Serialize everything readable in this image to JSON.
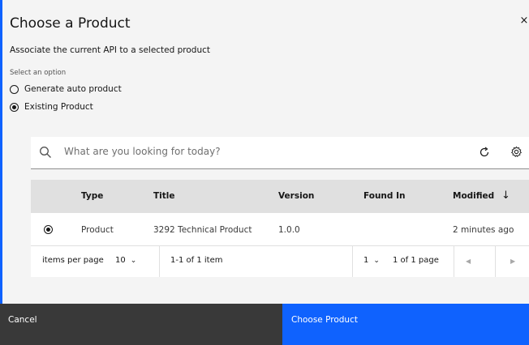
{
  "modal": {
    "title": "Choose a Product",
    "close_glyph": "×",
    "subtitle": "Associate the current API to a selected product"
  },
  "options": {
    "label": "Select an option",
    "items": [
      {
        "label": "Generate auto product",
        "selected": false
      },
      {
        "label": "Existing Product",
        "selected": true
      }
    ]
  },
  "search": {
    "placeholder": "What are you looking for today?",
    "icons": [
      "search-icon",
      "refresh-icon",
      "gear-icon"
    ]
  },
  "table": {
    "headers": {
      "type": "Type",
      "title": "Title",
      "version": "Version",
      "found_in": "Found In",
      "modified": "Modified",
      "sort_glyph": "↓"
    },
    "rows": [
      {
        "selected": true,
        "type": "Product",
        "title": "3292 Technical Product",
        "version": "1.0.0",
        "found_in": "",
        "modified": "2 minutes ago"
      }
    ]
  },
  "pagination": {
    "items_per_page_label": "items per page",
    "items_per_page_value": "10",
    "range": "1-1 of 1 item",
    "page_value": "1",
    "page_of": "1 of 1 page",
    "prev_glyph": "◀",
    "next_glyph": "▶"
  },
  "footer": {
    "cancel_label": "Cancel",
    "primary_label": "Choose Product"
  },
  "colors": {
    "accent": "#0f62fe",
    "secondary_button": "#393939",
    "header_bg": "#e0e0e0",
    "modal_bg": "#f4f4f4"
  }
}
